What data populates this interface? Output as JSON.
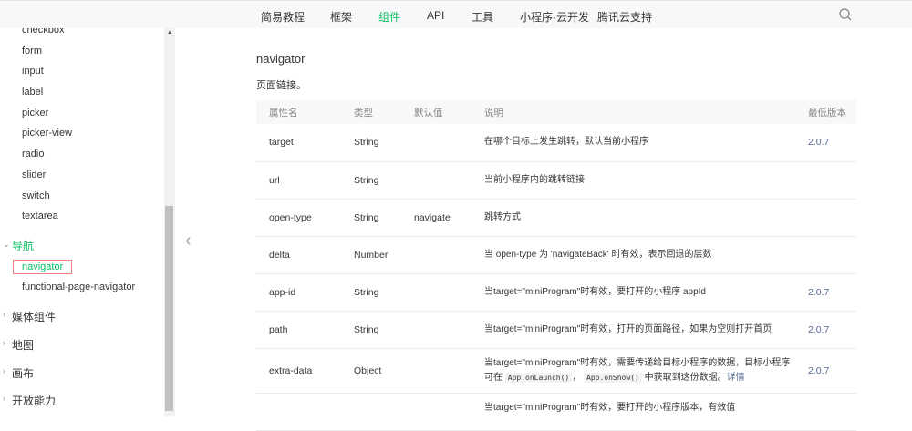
{
  "topnav": {
    "items": [
      "简易教程",
      "框架",
      "组件",
      "API",
      "工具",
      "小程序·云开发",
      "腾讯云支持"
    ],
    "active": 2
  },
  "sidebar": {
    "form_items": [
      "checkbox",
      "form",
      "input",
      "label",
      "picker",
      "picker-view",
      "radio",
      "slider",
      "switch",
      "textarea"
    ],
    "nav_group": "导航",
    "nav_items": [
      "navigator",
      "functional-page-navigator"
    ],
    "groups": [
      "媒体组件",
      "地图",
      "画布",
      "开放能力"
    ]
  },
  "page": {
    "title": "navigator",
    "description": "页面链接。"
  },
  "table": {
    "headers": [
      "属性名",
      "类型",
      "默认值",
      "说明",
      "最低版本"
    ],
    "rows": [
      {
        "name": "target",
        "type": "String",
        "default": "",
        "desc": "在哪个目标上发生跳转，默认当前小程序",
        "version": "2.0.7"
      },
      {
        "name": "url",
        "type": "String",
        "default": "",
        "desc": "当前小程序内的跳转链接",
        "version": ""
      },
      {
        "name": "open-type",
        "type": "String",
        "default": "navigate",
        "desc": "跳转方式",
        "version": ""
      },
      {
        "name": "delta",
        "type": "Number",
        "default": "",
        "desc": "当 open-type 为 'navigateBack' 时有效，表示回退的层数",
        "version": ""
      },
      {
        "name": "app-id",
        "type": "String",
        "default": "",
        "desc": "当target=\"miniProgram\"时有效，要打开的小程序 appId",
        "version": "2.0.7"
      },
      {
        "name": "path",
        "type": "String",
        "default": "",
        "desc": "当target=\"miniProgram\"时有效，打开的页面路径，如果为空则打开首页",
        "version": "2.0.7"
      }
    ],
    "extra": {
      "name": "extra-data",
      "type": "Object",
      "desc1": "当target=\"miniProgram\"时有效，需要传递给目标小程序的数据，目标小程序可在",
      "code1": "App.onLaunch()",
      "sep": "，",
      "code2": "App.onShow()",
      "desc2": "中获取到这份数据。",
      "link": "详情",
      "version": "2.0.7"
    },
    "last": {
      "desc": "当target=\"miniProgram\"时有效，要打开的小程序版本，有效值"
    }
  }
}
